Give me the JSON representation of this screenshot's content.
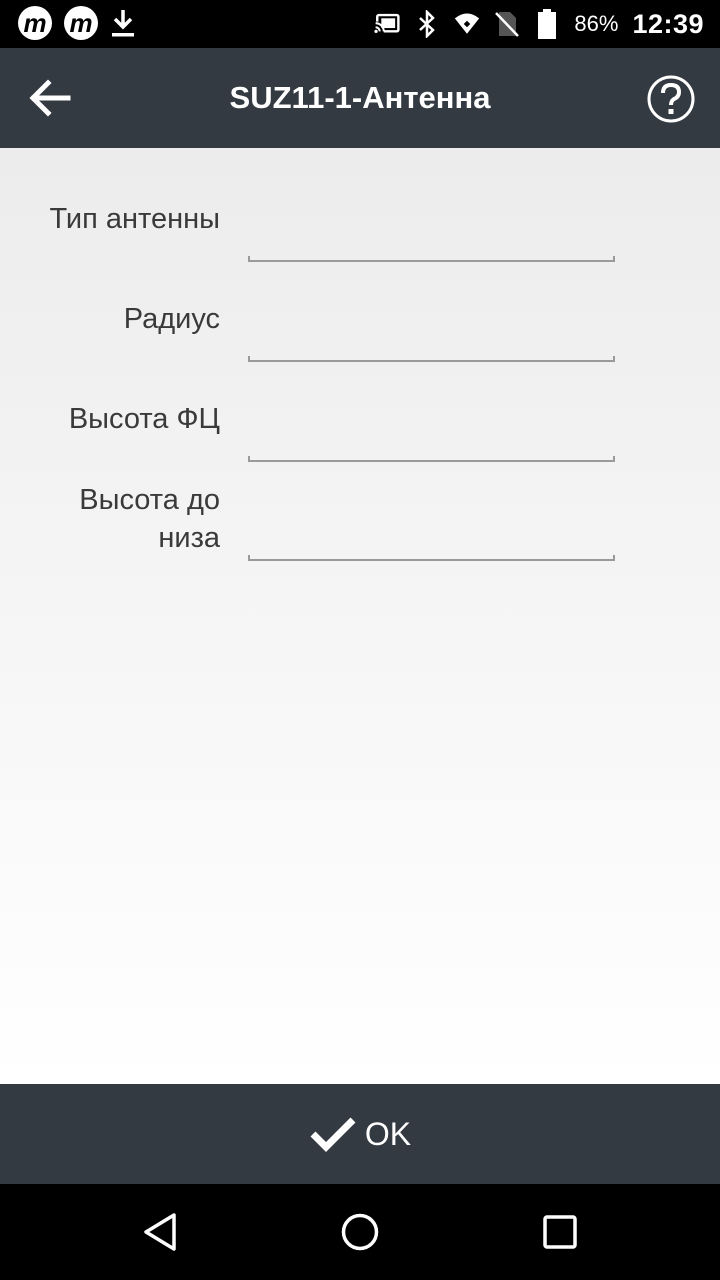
{
  "status_bar": {
    "battery_percent": "86%",
    "time": "12:39",
    "icons": [
      "app-m-icon",
      "app-m-icon",
      "download-icon",
      "cast-icon",
      "bluetooth-icon",
      "wifi-icon",
      "no-sim-icon",
      "battery-icon"
    ]
  },
  "app_bar": {
    "title": "SUZ11-1-Антенна"
  },
  "form": {
    "fields": [
      {
        "label": "Тип антенны",
        "value": ""
      },
      {
        "label": "Радиус",
        "value": ""
      },
      {
        "label": "Высота ФЦ",
        "value": ""
      },
      {
        "label_line1": "Высота до",
        "label_line2": "низа",
        "value": ""
      }
    ]
  },
  "ok_bar": {
    "label": "OK"
  },
  "colors": {
    "app_bar": "#343a42",
    "field_underline": "#9a9a9a",
    "text": "#3a3a3a"
  }
}
